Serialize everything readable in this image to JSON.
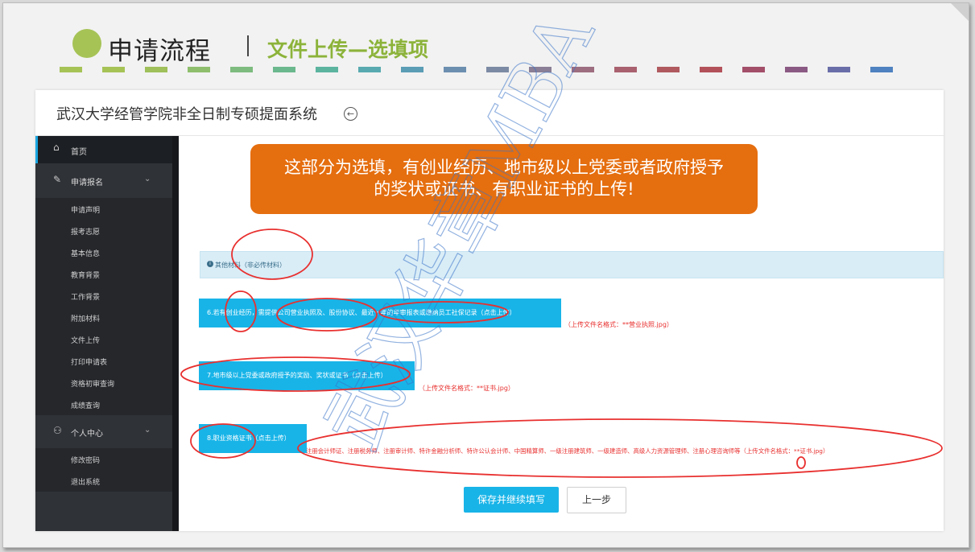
{
  "slide": {
    "title_main": "申请流程",
    "title_sub": "文件上传—选填项",
    "dash_colors": [
      "#a6c356",
      "#a6c356",
      "#9fc05a",
      "#8fbe6d",
      "#7dbb7e",
      "#6bb88e",
      "#5cb49f",
      "#58aab0",
      "#5a9db4",
      "#6c8fb0",
      "#7c8aa4",
      "#8a7f96",
      "#9d6d80",
      "#a9616f",
      "#b05a5f",
      "#b3515a",
      "#a34f6a",
      "#8b5a84",
      "#6a6ea8",
      "#4f82c0"
    ]
  },
  "header": {
    "app_title": "武汉大学经管学院非全日制专硕提面系统",
    "back_icon": "←"
  },
  "sidebar": {
    "home": {
      "icon": "⌂",
      "label": "首页"
    },
    "apply": {
      "icon": "✎",
      "label": "申请报名",
      "chevron": "⌄"
    },
    "apply_items": [
      "申请声明",
      "报考志愿",
      "基本信息",
      "教育背景",
      "工作背景",
      "附加材料",
      "文件上传",
      "打印申请表",
      "资格初审查询",
      "成绩查询"
    ],
    "personal": {
      "icon": "⚇",
      "label": "个人中心",
      "chevron": "⌄"
    },
    "personal_items": [
      "修改密码",
      "退出系统"
    ]
  },
  "banner": {
    "line1": "这部分为选填，有创业经历、地市级以上党委或者政府授予",
    "line2": "的奖状或证书、有职业证书的上传!"
  },
  "info": {
    "icon": "i",
    "label": "其他材料（非必传材料）"
  },
  "uploads": [
    {
      "label": "6.若有创业经历，需提供公司营业执照及、股份协议、最近一年的年审报表或缴纳员工社保记录（点击上传）",
      "note": "（上传文件名格式：**营业执照.jpg）"
    },
    {
      "label": "7.地市级以上党委或政府授予的奖励、奖状或证书（点击上传）",
      "note": "（上传文件名格式：**证书.jpg）"
    },
    {
      "label": "8.职业资格证书（点击上传）",
      "note": "注册会计师证、注册税务师、注册审计师、特许金融分析师、特许公认会计师、中国精算师、一级注册建筑师、一级建造师、高级人力资源管理师、注册心理咨询师等（上传文件名格式：**证书.jpg）"
    }
  ],
  "actions": {
    "save": "保存并继续填写",
    "prev": "上一步"
  },
  "watermark": {
    "line1": "武汉华章MBA"
  },
  "colors": {
    "accent": "#18b4e8",
    "banner": "#e56e0f",
    "annotation": "#e8302f",
    "sidebar": "#2f3237"
  }
}
